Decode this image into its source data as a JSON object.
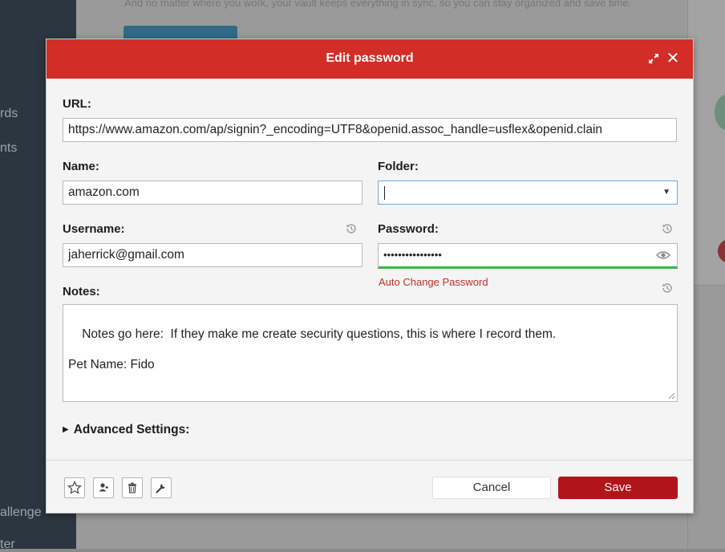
{
  "background": {
    "sidebar_items": [
      "rds",
      "nts",
      "allenge",
      "ter"
    ],
    "main_text": "And no matter where you work, your vault keeps everything in sync, so you can stay organized and save time."
  },
  "dialog": {
    "title": "Edit password",
    "fields": {
      "url": {
        "label": "URL:",
        "value": "https://www.amazon.com/ap/signin?_encoding=UTF8&openid.assoc_handle=usflex&openid.clain"
      },
      "name": {
        "label": "Name:",
        "value": "amazon.com"
      },
      "folder": {
        "label": "Folder:",
        "value": ""
      },
      "username": {
        "label": "Username:",
        "value": "jaherrick@gmail.com"
      },
      "password": {
        "label": "Password:",
        "value": "••••••••••••••••"
      },
      "notes": {
        "label": "Notes:",
        "value": "Notes go here:  If they make me create security questions, this is where I record them.\n\nPet Name: Fido"
      }
    },
    "auto_change_label": "Auto Change Password",
    "advanced_label": "Advanced Settings:",
    "buttons": {
      "cancel": "Cancel",
      "save": "Save"
    },
    "tools": [
      "star-icon",
      "share-icon",
      "trash-icon",
      "wrench-icon"
    ]
  },
  "colors": {
    "header": "#d32d27",
    "save": "#b1141b",
    "strength": "#3ab54a",
    "link": "#c0302b"
  }
}
